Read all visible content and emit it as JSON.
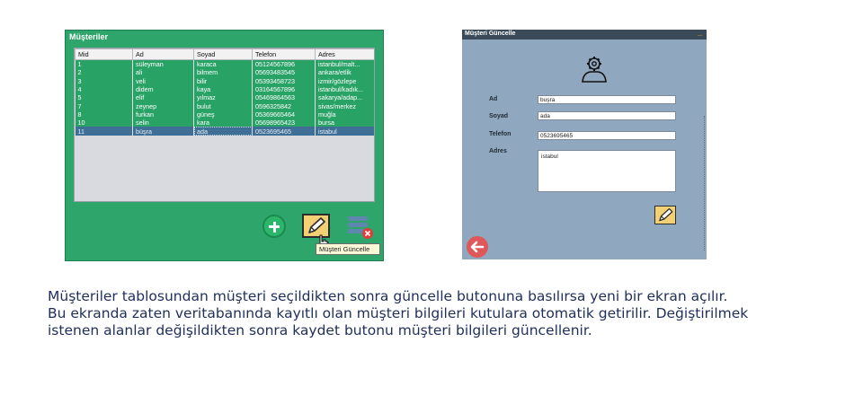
{
  "left_window": {
    "title": "Müşteriler",
    "columns": [
      "Mid",
      "Ad",
      "Soyad",
      "Telefon",
      "Adres"
    ],
    "rows": [
      [
        "1",
        "süleyman",
        "karaca",
        "05124567896",
        "istanbul/malt..."
      ],
      [
        "2",
        "ali",
        "bilmem",
        "05693483545",
        "ankara/etlik"
      ],
      [
        "3",
        "veli",
        "bilir",
        "05393458723",
        "izmir/gözlepe"
      ],
      [
        "4",
        "didem",
        "kaya",
        "03164567896",
        "istanbul/kadık..."
      ],
      [
        "5",
        "elif",
        "yılmaz",
        "05469864563",
        "sakarya/adap..."
      ],
      [
        "7",
        "zeynep",
        "bulut",
        "0596325842",
        "sivas/merkez"
      ],
      [
        "8",
        "furkan",
        "güneş",
        "05369665464",
        "muğla"
      ],
      [
        "10",
        "selin",
        "kara",
        "05698965423",
        "bursa"
      ],
      [
        "11",
        "büşra",
        "ada",
        "0523695465",
        "istabul"
      ]
    ],
    "selected_row": 8,
    "tooltip": "Müşteri Güncelle",
    "icons": {
      "add": "plus-circle-icon",
      "edit": "pencil-icon",
      "delete": "delete-list-icon"
    }
  },
  "right_window": {
    "title": "Müşteri Güncelle",
    "title_marker": "_",
    "fields": {
      "ad_label": "Ad",
      "ad_value": "buşra",
      "soyad_label": "Soyad",
      "soyad_value": "ada",
      "telefon_label": "Telefon",
      "telefon_value": "0523695465",
      "adres_label": "Adres",
      "adres_value": "istabul"
    },
    "icons": {
      "header": "user-gear-icon",
      "save": "pencil-icon",
      "back": "arrow-left-icon"
    }
  },
  "caption": {
    "line1": "Müşteriler tablosundan müşteri seçildikten sonra güncelle butonuna basılırsa yeni bir ekran açılır.",
    "line2": "Bu ekranda zaten veritabanında kayıtlı olan müşteri bilgileri kutulara otomatik getirilir. Değiştirilmek",
    "line3": "istenen alanlar değişildikten sonra kaydet butonu müşteri bilgileri güncellenir."
  },
  "colors": {
    "left_bg": "#2ea56a",
    "selected_row": "#3f6f97",
    "right_bg": "#8fa8bf",
    "edit_button": "#f3d074",
    "back_button": "#e0575a",
    "caption_text": "#1f2f5a"
  }
}
